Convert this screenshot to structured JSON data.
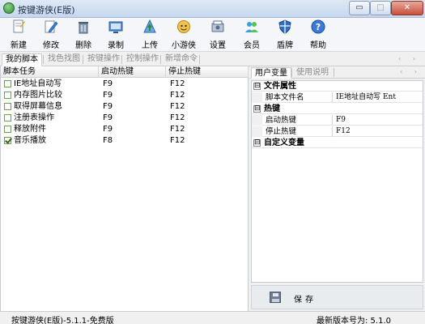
{
  "window": {
    "title": "按键游侠(E版)",
    "min_glyph": "▭",
    "max_glyph": "□",
    "close_glyph": "✕"
  },
  "toolbar": [
    {
      "label": "新建",
      "icon": "new-file-icon"
    },
    {
      "label": "修改",
      "icon": "edit-icon"
    },
    {
      "label": "删除",
      "icon": "delete-icon"
    },
    {
      "label": "录制",
      "icon": "record-icon"
    },
    {
      "label": "上传",
      "icon": "upload-icon"
    },
    {
      "label": "小游侠",
      "icon": "mascot-icon"
    },
    {
      "label": "设置",
      "icon": "settings-icon"
    },
    {
      "label": "会员",
      "icon": "member-icon"
    },
    {
      "label": "盾牌",
      "icon": "shield-icon"
    },
    {
      "label": "帮助",
      "icon": "help-icon"
    }
  ],
  "tabs": [
    "我的脚本",
    "找色找图",
    "按键操作",
    "控制操作",
    "新增命令"
  ],
  "tab_arrows": "‹ ›",
  "script_table": {
    "headers": [
      "脚本任务",
      "启动热键",
      "停止热键"
    ],
    "rows": [
      {
        "name": "IE地址自动写",
        "start": "F9",
        "stop": "F12",
        "checked": false
      },
      {
        "name": "内存图片比较",
        "start": "F9",
        "stop": "F12",
        "checked": false
      },
      {
        "name": "取得屏幕信息",
        "start": "F9",
        "stop": "F12",
        "checked": false
      },
      {
        "name": "注册表操作",
        "start": "F9",
        "stop": "F12",
        "checked": false
      },
      {
        "name": "释放附件",
        "start": "F9",
        "stop": "F12",
        "checked": false
      },
      {
        "name": "音乐播放",
        "start": "F8",
        "stop": "F12",
        "checked": true
      }
    ]
  },
  "right_tabs": [
    "用户变量",
    "使用说明"
  ],
  "properties": {
    "cat1": "文件属性",
    "cat1_name": "脚本文件名",
    "cat1_value": "IE地址自动写 Ent",
    "cat2": "热键",
    "cat2_start_name": "启动热键",
    "cat2_start_value": "F9",
    "cat2_stop_name": "停止热键",
    "cat2_stop_value": "F12",
    "cat3": "自定义变量",
    "toggle": "⊟"
  },
  "save_label": "保存",
  "status": {
    "left": "按键游侠(E版)-5.1.1-免费版",
    "right": "最新版本号为: 5.1.0"
  },
  "colors": {
    "accent": "#3a6fb5",
    "checkbox_border": "#6aa34f"
  }
}
